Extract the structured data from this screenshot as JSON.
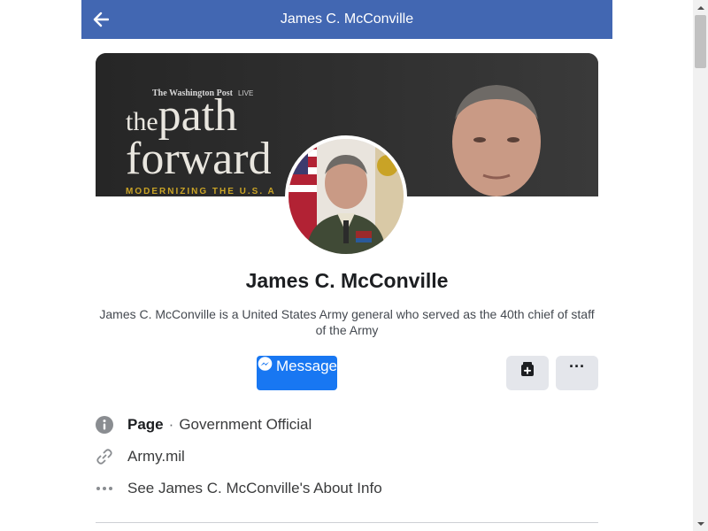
{
  "header": {
    "title": "James C. McConville",
    "back_icon": "arrow-left-icon"
  },
  "cover": {
    "publisher": "The Washington Post",
    "publisher_tag": "LIVE",
    "headline_small": "the",
    "headline_line1": "path",
    "headline_line2": "forward",
    "tagline": "MODERNIZING THE U.S. A"
  },
  "profile": {
    "name": "James C. McConville",
    "description": "James C. McConville is a United States Army general who served as the 40th chief of staff of the Army"
  },
  "actions": {
    "message_label": "Message",
    "message_icon": "messenger-icon",
    "save_icon": "bookmark-plus-icon",
    "more_icon": "more-icon",
    "more_glyph": "···"
  },
  "info": {
    "category_title": "Page",
    "category_separator": "·",
    "category_value": "Government Official",
    "category_icon": "info-icon",
    "website": "Army.mil",
    "website_icon": "link-icon",
    "about": "See James C. McConville's About Info",
    "about_icon": "more-dots-icon"
  },
  "colors": {
    "header_bg": "#4267b2",
    "primary_button": "#1877f2",
    "secondary_button": "#e4e6eb",
    "text": "#1c1e21"
  }
}
